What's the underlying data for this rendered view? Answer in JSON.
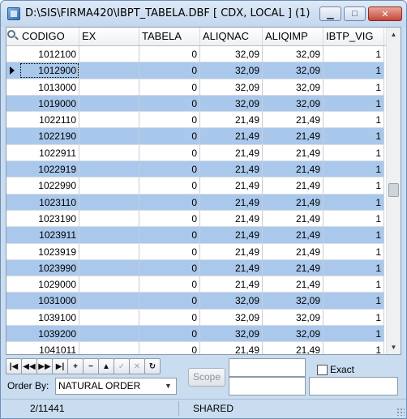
{
  "window": {
    "title": "D:\\SIS\\FIRMA420\\IBPT_TABELA.DBF [ CDX, LOCAL ] (1)",
    "controls": [
      "minimize",
      "maximize",
      "close"
    ]
  },
  "grid": {
    "columns": [
      "CODIGO",
      "EX",
      "TABELA",
      "ALIQNAC",
      "ALIQIMP",
      "IBTP_VIG"
    ],
    "active_row": 1,
    "rows": [
      {
        "codigo": "1012100",
        "ex": "",
        "tabela": "0",
        "aliqnac": "32,09",
        "aliqimp": "32,09",
        "vig": "1"
      },
      {
        "codigo": "1012900",
        "ex": "",
        "tabela": "0",
        "aliqnac": "32,09",
        "aliqimp": "32,09",
        "vig": "1"
      },
      {
        "codigo": "1013000",
        "ex": "",
        "tabela": "0",
        "aliqnac": "32,09",
        "aliqimp": "32,09",
        "vig": "1"
      },
      {
        "codigo": "1019000",
        "ex": "",
        "tabela": "0",
        "aliqnac": "32,09",
        "aliqimp": "32,09",
        "vig": "1"
      },
      {
        "codigo": "1022110",
        "ex": "",
        "tabela": "0",
        "aliqnac": "21,49",
        "aliqimp": "21,49",
        "vig": "1"
      },
      {
        "codigo": "1022190",
        "ex": "",
        "tabela": "0",
        "aliqnac": "21,49",
        "aliqimp": "21,49",
        "vig": "1"
      },
      {
        "codigo": "1022911",
        "ex": "",
        "tabela": "0",
        "aliqnac": "21,49",
        "aliqimp": "21,49",
        "vig": "1"
      },
      {
        "codigo": "1022919",
        "ex": "",
        "tabela": "0",
        "aliqnac": "21,49",
        "aliqimp": "21,49",
        "vig": "1"
      },
      {
        "codigo": "1022990",
        "ex": "",
        "tabela": "0",
        "aliqnac": "21,49",
        "aliqimp": "21,49",
        "vig": "1"
      },
      {
        "codigo": "1023110",
        "ex": "",
        "tabela": "0",
        "aliqnac": "21,49",
        "aliqimp": "21,49",
        "vig": "1"
      },
      {
        "codigo": "1023190",
        "ex": "",
        "tabela": "0",
        "aliqnac": "21,49",
        "aliqimp": "21,49",
        "vig": "1"
      },
      {
        "codigo": "1023911",
        "ex": "",
        "tabela": "0",
        "aliqnac": "21,49",
        "aliqimp": "21,49",
        "vig": "1"
      },
      {
        "codigo": "1023919",
        "ex": "",
        "tabela": "0",
        "aliqnac": "21,49",
        "aliqimp": "21,49",
        "vig": "1"
      },
      {
        "codigo": "1023990",
        "ex": "",
        "tabela": "0",
        "aliqnac": "21,49",
        "aliqimp": "21,49",
        "vig": "1"
      },
      {
        "codigo": "1029000",
        "ex": "",
        "tabela": "0",
        "aliqnac": "21,49",
        "aliqimp": "21,49",
        "vig": "1"
      },
      {
        "codigo": "1031000",
        "ex": "",
        "tabela": "0",
        "aliqnac": "32,09",
        "aliqimp": "32,09",
        "vig": "1"
      },
      {
        "codigo": "1039100",
        "ex": "",
        "tabela": "0",
        "aliqnac": "32,09",
        "aliqimp": "32,09",
        "vig": "1"
      },
      {
        "codigo": "1039200",
        "ex": "",
        "tabela": "0",
        "aliqnac": "32,09",
        "aliqimp": "32,09",
        "vig": "1"
      },
      {
        "codigo": "1041011",
        "ex": "",
        "tabela": "0",
        "aliqnac": "21,49",
        "aliqimp": "21,49",
        "vig": "1"
      }
    ]
  },
  "toolbar": {
    "buttons": [
      {
        "name": "first-record",
        "glyph": "|◀"
      },
      {
        "name": "prev-page",
        "glyph": "◀◀"
      },
      {
        "name": "next-page",
        "glyph": "▶▶"
      },
      {
        "name": "last-record",
        "glyph": "▶|"
      },
      {
        "name": "add-record",
        "glyph": "+"
      },
      {
        "name": "delete-record",
        "glyph": "−"
      },
      {
        "name": "edit-record",
        "glyph": "▲"
      },
      {
        "name": "post-record",
        "glyph": "✓"
      },
      {
        "name": "cancel-record",
        "glyph": "✕"
      },
      {
        "name": "refresh",
        "glyph": "↻"
      }
    ]
  },
  "order": {
    "label": "Order By:",
    "selected": "NATURAL ORDER"
  },
  "scope": {
    "button_label": "Scope",
    "exact_label": "Exact",
    "exact_checked": false
  },
  "status": {
    "position": "2/11441",
    "mode": "SHARED"
  },
  "colors": {
    "window_frame": "#c9dcf0",
    "alt_row": "#a9c8ec",
    "close_button": "#c6463a"
  }
}
